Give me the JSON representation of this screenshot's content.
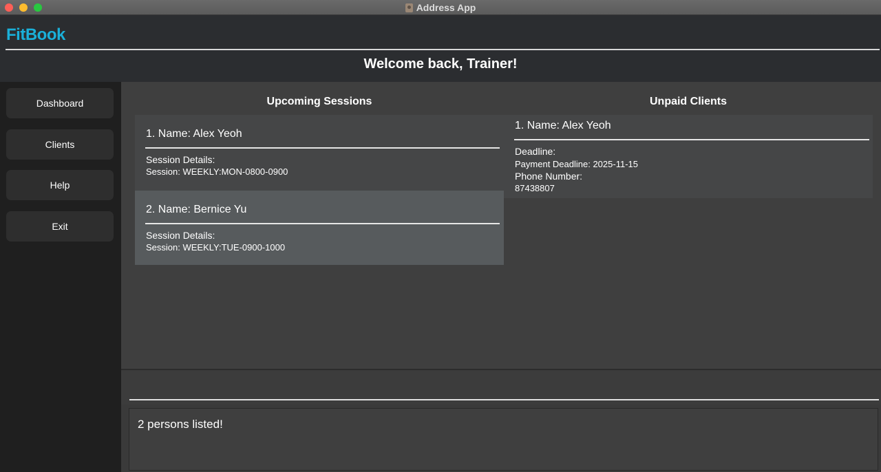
{
  "window": {
    "title": "Address App"
  },
  "header": {
    "brand": "FitBook",
    "welcome": "Welcome back, Trainer!"
  },
  "sidebar": {
    "items": [
      {
        "label": "Dashboard"
      },
      {
        "label": "Clients"
      },
      {
        "label": "Help"
      },
      {
        "label": "Exit"
      }
    ]
  },
  "sessions": {
    "title": "Upcoming Sessions",
    "items": [
      {
        "name": "1. Name: Alex Yeoh",
        "details_label": "Session Details:",
        "details": "Session: WEEKLY:MON-0800-0900"
      },
      {
        "name": "2. Name: Bernice Yu",
        "details_label": "Session Details:",
        "details": "Session: WEEKLY:TUE-0900-1000"
      }
    ]
  },
  "unpaid": {
    "title": "Unpaid Clients",
    "items": [
      {
        "name": "1. Name: Alex Yeoh",
        "deadline_label": "Deadline:",
        "deadline": "Payment Deadline: 2025-11-15",
        "phone_label": "Phone Number:",
        "phone": "87438807"
      }
    ]
  },
  "command": {
    "value": "",
    "placeholder": ""
  },
  "result": {
    "text": "2 persons listed!"
  },
  "colors": {
    "brand": "#1ab0d9",
    "sidebar_bg": "#1f1f1f",
    "main_bg": "#3f3f3f",
    "selected_card": "#575b5d"
  }
}
